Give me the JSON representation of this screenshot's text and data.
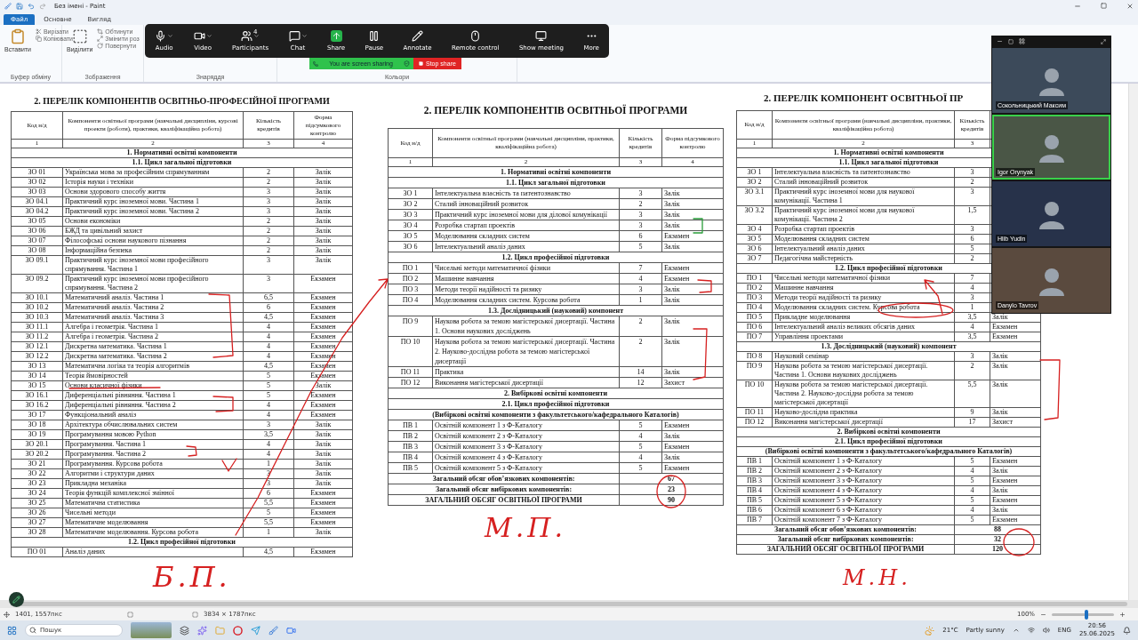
{
  "window": {
    "title": "Без імені - Paint"
  },
  "menu_tabs": [
    {
      "label": "Файл",
      "selected": true
    },
    {
      "label": "Основне",
      "selected": false
    },
    {
      "label": "Вигляд",
      "selected": false
    }
  ],
  "ribbon": {
    "groups": [
      {
        "label": "Буфер обміну",
        "large": "Вставити",
        "small": [
          "Вирізати",
          "Копіювати"
        ]
      },
      {
        "label": "Зображення",
        "large": "Виділити",
        "small": [
          "Обтинути",
          "Змінити роз",
          "Повернути"
        ]
      },
      {
        "label": "Знаряддя"
      },
      {
        "label": "Кольори"
      }
    ]
  },
  "meeting_toolbar": {
    "buttons": [
      {
        "label": "Audio",
        "kind": "mic",
        "caret": true
      },
      {
        "label": "Video",
        "kind": "camera",
        "caret": true
      },
      {
        "label": "Participants",
        "kind": "people",
        "caret": true,
        "badge": "4"
      },
      {
        "label": "Chat",
        "kind": "chat",
        "caret": true
      },
      {
        "label": "Share",
        "kind": "share",
        "caret": false
      },
      {
        "label": "Pause",
        "kind": "pause",
        "caret": false
      },
      {
        "label": "Annotate",
        "kind": "pen",
        "caret": false
      },
      {
        "label": "Remote control",
        "kind": "mouse",
        "caret": false
      },
      {
        "label": "Show meeting",
        "kind": "monitor",
        "caret": false
      },
      {
        "label": "More",
        "kind": "more",
        "caret": false
      }
    ],
    "sharing_notice": "You are screen sharing",
    "stop_label": "Stop share"
  },
  "documents": [
    {
      "title": "2. ПЕРЕЛІК КОМПОНЕНТІВ ОСВІТНЬО-ПРОФЕСІЙНОЇ ПРОГРАМИ",
      "header": {
        "code": "Код н/д",
        "name": "Компоненти освітньої програми (навчальні дисципліни, курсові проекти (роботи), практики, кваліфікаційна робота)",
        "credits": "Кількість кредитів",
        "form": "Форма підсумкового контролю"
      },
      "numbering": [
        "1",
        "2",
        "3",
        "4"
      ],
      "rows": [
        {
          "kind": "section",
          "text": "1. Нормативні освітні компоненти"
        },
        {
          "kind": "section",
          "text": "1.1. Цикл загальної підготовки"
        },
        {
          "kind": "item",
          "code": "ЗО 01",
          "name": "Українська мова за професійним спрямуванням",
          "credits": "2",
          "form": "Залік"
        },
        {
          "kind": "item",
          "code": "ЗО 02",
          "name": "Історія науки і техніки",
          "credits": "2",
          "form": "Залік"
        },
        {
          "kind": "item",
          "code": "ЗО 03",
          "name": "Основи здорового способу життя",
          "credits": "3",
          "form": "Залік"
        },
        {
          "kind": "item",
          "code": "ЗО 04.1",
          "name": "Практичний курс іноземної мови. Частина 1",
          "credits": "3",
          "form": "Залік"
        },
        {
          "kind": "item",
          "code": "ЗО 04.2",
          "name": "Практичний курс іноземної мови. Частина 2",
          "credits": "3",
          "form": "Залік"
        },
        {
          "kind": "item",
          "code": "ЗО 05",
          "name": "Основи економіки",
          "credits": "2",
          "form": "Залік"
        },
        {
          "kind": "item",
          "code": "ЗО 06",
          "name": "БЖД та цивільний захист",
          "credits": "2",
          "form": "Залік"
        },
        {
          "kind": "item",
          "code": "ЗО 07",
          "name": "Філософські основи наукового пізнання",
          "credits": "2",
          "form": "Залік"
        },
        {
          "kind": "item",
          "code": "ЗО 08",
          "name": "Інформаційна безпека",
          "credits": "2",
          "form": "Залік"
        },
        {
          "kind": "item",
          "code": "ЗО 09.1",
          "name": "Практичний курс іноземної мови професійного спрямування. Частина 1",
          "credits": "3",
          "form": "Залік"
        },
        {
          "kind": "item",
          "code": "ЗО 09.2",
          "name": "Практичний курс іноземної мови професійного спрямування. Частина 2",
          "credits": "3",
          "form": "Екзамен"
        },
        {
          "kind": "item",
          "code": "ЗО 10.1",
          "name": "Математичний аналіз. Частина 1",
          "credits": "6,5",
          "form": "Екзамен"
        },
        {
          "kind": "item",
          "code": "ЗО 10.2",
          "name": "Математичний аналіз. Частина 2",
          "credits": "6",
          "form": "Екзамен"
        },
        {
          "kind": "item",
          "code": "ЗО 10.3",
          "name": "Математичний аналіз. Частина 3",
          "credits": "4,5",
          "form": "Екзамен"
        },
        {
          "kind": "item",
          "code": "ЗО 11.1",
          "name": "Алгебра і геометрія. Частина 1",
          "credits": "4",
          "form": "Екзамен"
        },
        {
          "kind": "item",
          "code": "ЗО 11.2",
          "name": "Алгебра і геометрія. Частина 2",
          "credits": "4",
          "form": "Екзамен"
        },
        {
          "kind": "item",
          "code": "ЗО 12.1",
          "name": "Дискретна математика. Частина 1",
          "credits": "4",
          "form": "Екзамен"
        },
        {
          "kind": "item",
          "code": "ЗО 12.2",
          "name": "Дискретна математика. Частина 2",
          "credits": "4",
          "form": "Екзамен"
        },
        {
          "kind": "item",
          "code": "ЗО 13",
          "name": "Математична логіка та теорія алгоритмів",
          "credits": "4,5",
          "form": "Екзамен"
        },
        {
          "kind": "item",
          "code": "ЗО 14",
          "name": "Теорія ймовірностей",
          "credits": "5",
          "form": "Екзамен"
        },
        {
          "kind": "item",
          "code": "ЗО 15",
          "name": "Основи класичної фізики",
          "credits": "5",
          "form": "Залік"
        },
        {
          "kind": "item",
          "code": "ЗО 16.1",
          "name": "Диференціальні рівняння. Частина 1",
          "credits": "5",
          "form": "Екзамен"
        },
        {
          "kind": "item",
          "code": "ЗО 16.2",
          "name": "Диференціальні рівняння. Частина 2",
          "credits": "4",
          "form": "Екзамен"
        },
        {
          "kind": "item",
          "code": "ЗО 17",
          "name": "Функціональний аналіз",
          "credits": "4",
          "form": "Екзамен"
        },
        {
          "kind": "item",
          "code": "ЗО 18",
          "name": "Архітектура обчислювальних систем",
          "credits": "3",
          "form": "Залік"
        },
        {
          "kind": "item",
          "code": "ЗО 19",
          "name": "Програмування мовою Python",
          "credits": "3,5",
          "form": "Залік"
        },
        {
          "kind": "item",
          "code": "ЗО 20.1",
          "name": "Програмування. Частина 1",
          "credits": "4",
          "form": "Залік"
        },
        {
          "kind": "item",
          "code": "ЗО 20.2",
          "name": "Програмування. Частина 2",
          "credits": "4",
          "form": "Залік"
        },
        {
          "kind": "item",
          "code": "ЗО 21",
          "name": "Програмування. Курсова робота",
          "credits": "1",
          "form": "Залік"
        },
        {
          "kind": "item",
          "code": "ЗО 22",
          "name": "Алгоритми і структури даних",
          "credits": "3",
          "form": "Залік"
        },
        {
          "kind": "item",
          "code": "ЗО 23",
          "name": "Прикладна механіка",
          "credits": "3",
          "form": "Залік"
        },
        {
          "kind": "item",
          "code": "ЗО 24",
          "name": "Теорія функцій комплексної змінної",
          "credits": "6",
          "form": "Екзамен"
        },
        {
          "kind": "item",
          "code": "ЗО 25",
          "name": "Математична статистика",
          "credits": "5,5",
          "form": "Екзамен"
        },
        {
          "kind": "item",
          "code": "ЗО 26",
          "name": "Чисельні методи",
          "credits": "5",
          "form": "Екзамен"
        },
        {
          "kind": "item",
          "code": "ЗО 27",
          "name": "Математичне моделювання",
          "credits": "5,5",
          "form": "Екзамен"
        },
        {
          "kind": "item",
          "code": "ЗО 28",
          "name": "Математичне моделювання. Курсова робота",
          "credits": "1",
          "form": "Залік"
        },
        {
          "kind": "section",
          "text": "1.2. Цикл професійної підготовки"
        },
        {
          "kind": "item",
          "code": "ПО 01",
          "name": "Аналіз даних",
          "credits": "4,5",
          "form": "Екзамен"
        }
      ]
    },
    {
      "title": "2. ПЕРЕЛІК КОМПОНЕНТІВ ОСВІТНЬОЇ ПРОГРАМИ",
      "header": {
        "code": "Код н/д",
        "name": "Компоненти освітньої програми (навчальні дисципліни, практики, кваліфікаційна робота)",
        "credits": "Кількість кредитів",
        "form": "Форма підсумкового контролю"
      },
      "numbering": [
        "1",
        "2",
        "3",
        "4"
      ],
      "rows": [
        {
          "kind": "section",
          "text": "1. Нормативні освітні компоненти"
        },
        {
          "kind": "section",
          "text": "1.1. Цикл загальної підготовки"
        },
        {
          "kind": "item",
          "code": "ЗО 1",
          "name": "Інтелектуальна власність та патентознавство",
          "credits": "3",
          "form": "Залік"
        },
        {
          "kind": "item",
          "code": "ЗО 2",
          "name": "Сталий інноваційний розвиток",
          "credits": "2",
          "form": "Залік"
        },
        {
          "kind": "item",
          "code": "ЗО 3",
          "name": "Практичний курс іноземної мови для ділової комунікації",
          "credits": "3",
          "form": "Залік"
        },
        {
          "kind": "item",
          "code": "ЗО 4",
          "name": "Розробка стартап проектів",
          "credits": "3",
          "form": "Залік"
        },
        {
          "kind": "item",
          "code": "ЗО 5",
          "name": "Моделювання складних систем",
          "credits": "6",
          "form": "Екзамен"
        },
        {
          "kind": "item",
          "code": "ЗО 6",
          "name": "Інтелектуальний аналіз даних",
          "credits": "5",
          "form": "Залік"
        },
        {
          "kind": "section",
          "text": "1.2. Цикл професійної підготовки"
        },
        {
          "kind": "item",
          "code": "ПО 1",
          "name": "Чисельні методи математичної фізики",
          "credits": "7",
          "form": "Екзамен"
        },
        {
          "kind": "item",
          "code": "ПО 2",
          "name": "Машинне навчання",
          "credits": "4",
          "form": "Екзамен"
        },
        {
          "kind": "item",
          "code": "ПО 3",
          "name": "Методи теорії надійності та ризику",
          "credits": "3",
          "form": "Залік"
        },
        {
          "kind": "item",
          "code": "ПО 4",
          "name": "Моделювання складних систем. Курсова робота",
          "credits": "1",
          "form": "Залік"
        },
        {
          "kind": "section",
          "text": "1.3. Дослідницький (науковий) компонент"
        },
        {
          "kind": "item",
          "code": "ПО 9",
          "name": "Наукова робота за темою магістерської дисертації. Частина 1. Основи наукових досліджень",
          "credits": "2",
          "form": "Залік"
        },
        {
          "kind": "item",
          "code": "ПО 10",
          "name": "Наукова робота за темою магістерської дисертації. Частина 2. Науково-дослідна робота за темою магістерської дисертації",
          "credits": "2",
          "form": "Залік"
        },
        {
          "kind": "item",
          "code": "ПО 11",
          "name": "Практика",
          "credits": "14",
          "form": "Залік"
        },
        {
          "kind": "item",
          "code": "ПО 12",
          "name": "Виконання магістерської дисертації",
          "credits": "12",
          "form": "Захист"
        },
        {
          "kind": "section",
          "text": "2. Вибіркові освітні компоненти"
        },
        {
          "kind": "section",
          "text": "2.1. Цикл професійної підготовки"
        },
        {
          "kind": "section",
          "text": "(Вибіркові освітні компоненти з факультетського/кафедрального Каталогів)"
        },
        {
          "kind": "item",
          "code": "ПВ 1",
          "name": "Освітній компонент 1 з Ф-Каталогу",
          "credits": "5",
          "form": "Екзамен"
        },
        {
          "kind": "item",
          "code": "ПВ 2",
          "name": "Освітній компонент 2 з Ф-Каталогу",
          "credits": "4",
          "form": "Залік"
        },
        {
          "kind": "item",
          "code": "ПВ 3",
          "name": "Освітній компонент 3 з Ф-Каталогу",
          "credits": "5",
          "form": "Екзамен"
        },
        {
          "kind": "item",
          "code": "ПВ 4",
          "name": "Освітній компонент 4 з Ф-Каталогу",
          "credits": "4",
          "form": "Залік"
        },
        {
          "kind": "item",
          "code": "ПВ 5",
          "name": "Освітній компонент 5 з Ф-Каталогу",
          "credits": "5",
          "form": "Екзамен"
        },
        {
          "kind": "total",
          "label": "Загальний обсяг обов’язкових компонентів:",
          "value": "67"
        },
        {
          "kind": "total",
          "label": "Загальний обсяг вибіркових компонентів:",
          "value": "23"
        },
        {
          "kind": "total",
          "label": "ЗАГАЛЬНИЙ ОБСЯГ ОСВІТНЬОЇ ПРОГРАМИ",
          "value": "90"
        }
      ]
    },
    {
      "title": "2. ПЕРЕЛІК КОМПОНЕНТ ОСВІТНЬОЇ ПР",
      "header": {
        "code": "Код н/д",
        "name": "Компоненти освітньої програми (навчальні дисципліни, практики, кваліфікаційна робота)",
        "credits": "Кількість кредитів"
      },
      "numbering": [
        "1",
        "2",
        "3"
      ],
      "rows": [
        {
          "kind": "section",
          "text": "1. Нормативні освітні компоненти"
        },
        {
          "kind": "section",
          "text": "1.1. Цикл загальної підготовки"
        },
        {
          "kind": "item",
          "code": "ЗО 1",
          "name": "Інтелектуальна власність та патентознавство",
          "credits": "3"
        },
        {
          "kind": "item",
          "code": "ЗО 2",
          "name": "Сталий інноваційний розвиток",
          "credits": "2"
        },
        {
          "kind": "item",
          "code": "ЗО 3.1",
          "name": "Практичний курс іноземної мови для наукової комунікації. Частина 1",
          "credits": "3"
        },
        {
          "kind": "item",
          "code": "ЗО 3.2",
          "name": "Практичний курс іноземної мови для наукової комунікації. Частина 2",
          "credits": "1,5"
        },
        {
          "kind": "item",
          "code": "ЗО 4",
          "name": "Розробка стартап проектів",
          "credits": "3"
        },
        {
          "kind": "item",
          "code": "ЗО 5",
          "name": "Моделювання складних систем",
          "credits": "6"
        },
        {
          "kind": "item",
          "code": "ЗО 6",
          "name": "Інтелектуальний аналіз даних",
          "credits": "5"
        },
        {
          "kind": "item",
          "code": "ЗО 7",
          "name": "Педагогічна майстерність",
          "credits": "2"
        },
        {
          "kind": "section",
          "text": "1.2. Цикл професійної підготовки"
        },
        {
          "kind": "item",
          "code": "ПО 1",
          "name": "Чисельні методи математичної фізики",
          "credits": "7"
        },
        {
          "kind": "item",
          "code": "ПО 2",
          "name": "Машинне навчання",
          "credits": "4"
        },
        {
          "kind": "item",
          "code": "ПО 3",
          "name": "Методи теорії надійності та ризику",
          "credits": "3"
        },
        {
          "kind": "item",
          "code": "ПО 4",
          "name": "Моделювання складних систем. Курсова робота",
          "credits": "1"
        },
        {
          "kind": "item",
          "code": "ПО 5",
          "name": "Прикладне моделювання",
          "credits": "3,5",
          "form": "Залік"
        },
        {
          "kind": "item",
          "code": "ПО 6",
          "name": "Інтелектуальний аналіз великих обсягів даних",
          "credits": "4",
          "form": "Екзамен"
        },
        {
          "kind": "item",
          "code": "ПО 7",
          "name": "Управління проектами",
          "credits": "3,5",
          "form": "Екзамен"
        },
        {
          "kind": "section",
          "text": "1.3. Дослідницький (науковий) компонент"
        },
        {
          "kind": "item",
          "code": "ПО 8",
          "name": "Науковий семінар",
          "credits": "3",
          "form": "Залік"
        },
        {
          "kind": "item",
          "code": "ПО 9",
          "name": "Наукова робота за темою магістерської дисертації. Частина 1. Основи наукових досліджень",
          "credits": "2",
          "form": "Залік"
        },
        {
          "kind": "item",
          "code": "ПО 10",
          "name": "Наукова робота за темою магістерської дисертації. Частина 2. Науково-дослідна робота за темою магістерської дисертації",
          "credits": "5,5",
          "form": "Залік"
        },
        {
          "kind": "item",
          "code": "ПО 11",
          "name": "Науково-дослідна практика",
          "credits": "9",
          "form": "Залік"
        },
        {
          "kind": "item",
          "code": "ПО 12",
          "name": "Виконання магістерської дисертації",
          "credits": "17",
          "form": "Захист"
        },
        {
          "kind": "section",
          "text": "2. Вибіркові освітні компоненти"
        },
        {
          "kind": "section",
          "text": "2.1. Цикл професійної підготовки"
        },
        {
          "kind": "section",
          "text": "(Вибіркові освітні компоненти з факультетського/кафедрального Каталогів)"
        },
        {
          "kind": "item",
          "code": "ПВ 1",
          "name": "Освітній компонент 1 з Ф-Каталогу",
          "credits": "5",
          "form": "Екзамен"
        },
        {
          "kind": "item",
          "code": "ПВ 2",
          "name": "Освітній компонент 2 з Ф-Каталогу",
          "credits": "4",
          "form": "Залік"
        },
        {
          "kind": "item",
          "code": "ПВ 3",
          "name": "Освітній компонент 3 з Ф-Каталогу",
          "credits": "5",
          "form": "Екзамен"
        },
        {
          "kind": "item",
          "code": "ПВ 4",
          "name": "Освітній компонент 4 з Ф-Каталогу",
          "credits": "4",
          "form": "Залік"
        },
        {
          "kind": "item",
          "code": "ПВ 5",
          "name": "Освітній компонент 5 з Ф-Каталогу",
          "credits": "5",
          "form": "Екзамен"
        },
        {
          "kind": "item",
          "code": "ПВ 6",
          "name": "Освітній компонент 6 з Ф-Каталогу",
          "credits": "4",
          "form": "Залік"
        },
        {
          "kind": "item",
          "code": "ПВ 7",
          "name": "Освітній компонент 7 з Ф-Каталогу",
          "credits": "5",
          "form": "Екзамен"
        },
        {
          "kind": "total",
          "label": "Загальний обсяг обов’язкових компонентів:",
          "value": "88"
        },
        {
          "kind": "total",
          "label": "Загальний обсяг вибіркових компонентів:",
          "value": "32"
        },
        {
          "kind": "total",
          "label": "ЗАГАЛЬНИЙ ОБСЯГ ОСВІТНЬОЇ ПРОГРАМИ",
          "value": "120"
        }
      ]
    }
  ],
  "handwritten_notes": [
    "Б.П.",
    "М.П.",
    "М.Н."
  ],
  "video_panel": {
    "tiles": [
      {
        "name": "Сокольницький Максим",
        "active_speaker": false
      },
      {
        "name": "Igor Orynyak",
        "active_speaker": true
      },
      {
        "name": "Hlib Yudin",
        "active_speaker": false
      },
      {
        "name": "Danylo Tavrov",
        "active_speaker": false
      }
    ]
  },
  "status_bar": {
    "cursor": "1401, 1557пкс",
    "image_size": "3834 × 1787пкс",
    "zoom": "100%",
    "zoom_slider": {
      "level": 0.55
    }
  },
  "taskbar": {
    "search_placeholder": "Пошук",
    "temperature": "21°C",
    "condition": "Partly sunny",
    "language": "ENG",
    "time": "20:56",
    "date": "25.06.2025"
  }
}
